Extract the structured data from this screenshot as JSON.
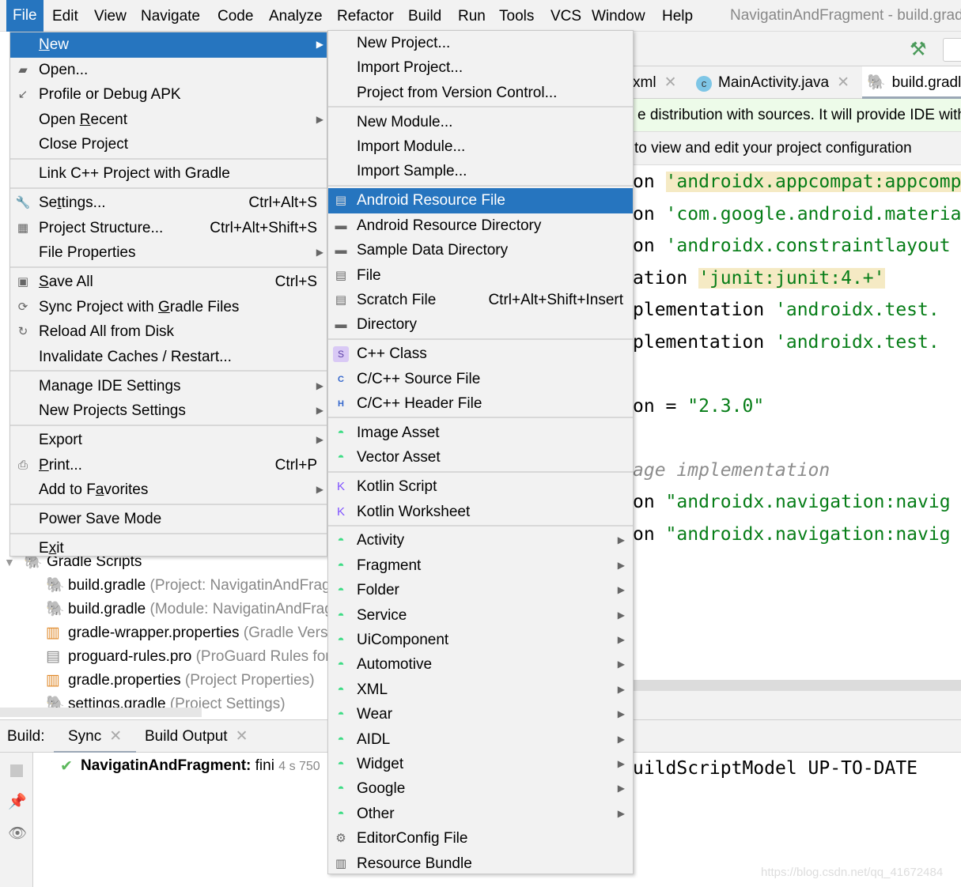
{
  "menubar": {
    "items": [
      "File",
      "Edit",
      "View",
      "Navigate",
      "Code",
      "Analyze",
      "Refactor",
      "Build",
      "Run",
      "Tools",
      "VCS",
      "Window",
      "Help"
    ],
    "active": "File"
  },
  "window_title": "NavigatinAndFragment - build.gradle",
  "editor_tabs": [
    {
      "label": "xml",
      "icon": "xml-icon"
    },
    {
      "label": "MainActivity.java",
      "icon": "class-c-icon"
    },
    {
      "label": "build.gradle",
      "icon": "gradle-elephant-icon",
      "selected": true
    }
  ],
  "notifications": [
    "e distribution with sources. It will provide IDE with",
    "to view and edit your project configuration"
  ],
  "code_lines": [
    [
      {
        "t": "on "
      },
      {
        "t": "'androidx.appcompat:appcompat",
        "c": "str hl"
      }
    ],
    [
      {
        "t": "on "
      },
      {
        "t": "'com.google.android.material",
        "c": "str"
      }
    ],
    [
      {
        "t": "on "
      },
      {
        "t": "'androidx.constraintlayout",
        "c": "str"
      }
    ],
    [
      {
        "t": "ation "
      },
      {
        "t": "'junit:junit:4.+'",
        "c": "str hl"
      }
    ],
    [
      {
        "t": "plementation "
      },
      {
        "t": "'androidx.test.",
        "c": "str"
      }
    ],
    [
      {
        "t": "plementation "
      },
      {
        "t": "'androidx.test.",
        "c": "str"
      }
    ],
    [],
    [
      {
        "t": "on = "
      },
      {
        "t": "\"2.3.0\"",
        "c": "str"
      }
    ],
    [],
    [
      {
        "t": "age implementation",
        "c": "cm"
      }
    ],
    [
      {
        "t": "on "
      },
      {
        "t": "\"androidx.navigation:navig",
        "c": "str"
      }
    ],
    [
      {
        "t": "on "
      },
      {
        "t": "\"androidx.navigation:navig",
        "c": "str"
      }
    ]
  ],
  "project_tree": {
    "root": "Gradle Scripts",
    "items": [
      {
        "name": "build.gradle",
        "hint": "(Project: NavigatinAndFragment)",
        "icon": "gradle-elephant-icon"
      },
      {
        "name": "build.gradle",
        "hint": "(Module: NavigatinAndFragment.app)",
        "icon": "gradle-elephant-icon"
      },
      {
        "name": "gradle-wrapper.properties",
        "hint": "(Gradle Version)",
        "icon": "properties-file-icon"
      },
      {
        "name": "proguard-rules.pro",
        "hint": "(ProGuard Rules for app)",
        "icon": "text-file-icon"
      },
      {
        "name": "gradle.properties",
        "hint": "(Project Properties)",
        "icon": "properties-file-icon"
      },
      {
        "name": "settings.gradle",
        "hint": "(Project Settings)",
        "icon": "gradle-elephant-icon"
      }
    ]
  },
  "build_panel": {
    "label": "Build:",
    "tabs": [
      "Sync",
      "Build Output"
    ],
    "status_title": "NavigatinAndFragment:",
    "status_text": "fini",
    "duration": "4 s 750",
    "output": "uildScriptModel UP-TO-DATE"
  },
  "file_menu": [
    {
      "label": "New",
      "u": 0,
      "arrow": true,
      "selected": true
    },
    {
      "label": "Open...",
      "icon": "folder-open-icon",
      "glyph": "▰"
    },
    {
      "label": "Profile or Debug APK",
      "icon": "profile-apk-icon",
      "glyph": "↙"
    },
    {
      "label": "Open Recent",
      "u": 5,
      "arrow": true
    },
    {
      "label": "Close Project"
    },
    {
      "sep": true
    },
    {
      "label": "Link C++ Project with Gradle"
    },
    {
      "sep": true
    },
    {
      "label": "Settings...",
      "u": 2,
      "shortcut": "Ctrl+Alt+S",
      "icon": "wrench-icon",
      "glyph": "🔧"
    },
    {
      "label": "Project Structure...",
      "shortcut": "Ctrl+Alt+Shift+S",
      "icon": "project-structure-icon",
      "glyph": "▦"
    },
    {
      "label": "File Properties",
      "arrow": true
    },
    {
      "sep": true
    },
    {
      "label": "Save All",
      "u": 0,
      "shortcut": "Ctrl+S",
      "icon": "save-icon",
      "glyph": "▣"
    },
    {
      "label": "Sync Project with Gradle Files",
      "u": 18,
      "icon": "gradle-sync-icon",
      "glyph": "⟳"
    },
    {
      "label": "Reload All from Disk",
      "icon": "reload-icon",
      "glyph": "↻"
    },
    {
      "label": "Invalidate Caches / Restart..."
    },
    {
      "sep": true
    },
    {
      "label": "Manage IDE Settings",
      "arrow": true
    },
    {
      "label": "New Projects Settings",
      "arrow": true
    },
    {
      "sep": true
    },
    {
      "label": "Export",
      "arrow": true
    },
    {
      "label": "Print...",
      "u": 0,
      "shortcut": "Ctrl+P",
      "icon": "printer-icon",
      "glyph": "⎙"
    },
    {
      "label": "Add to Favorites",
      "u": 8,
      "arrow": true
    },
    {
      "sep": true
    },
    {
      "label": "Power Save Mode"
    },
    {
      "sep": true
    },
    {
      "label": "Exit",
      "u": 1
    }
  ],
  "new_menu": [
    {
      "label": "New Project..."
    },
    {
      "label": "Import Project..."
    },
    {
      "label": "Project from Version Control..."
    },
    {
      "sep": true
    },
    {
      "label": "New Module..."
    },
    {
      "label": "Import Module..."
    },
    {
      "label": "Import Sample..."
    },
    {
      "sep": true
    },
    {
      "label": "Android Resource File",
      "selected": true,
      "icon": "android-resource-file-icon",
      "glyph": "▤"
    },
    {
      "label": "Android Resource Directory",
      "icon": "folder-icon",
      "glyph": "▬"
    },
    {
      "label": "Sample Data Directory",
      "icon": "folder-icon",
      "glyph": "▬"
    },
    {
      "label": "File",
      "icon": "file-icon",
      "glyph": "▤"
    },
    {
      "label": "Scratch File",
      "shortcut": "Ctrl+Alt+Shift+Insert",
      "icon": "scratch-file-icon",
      "glyph": "▤"
    },
    {
      "label": "Directory",
      "icon": "folder-icon",
      "glyph": "▬"
    },
    {
      "sep": true
    },
    {
      "label": "C++ Class",
      "icon": "cpp-class-icon",
      "glyph": "S"
    },
    {
      "label": "C/C++ Source File",
      "icon": "cpp-source-icon",
      "glyph": "C"
    },
    {
      "label": "C/C++ Header File",
      "icon": "cpp-header-icon",
      "glyph": "H"
    },
    {
      "sep": true
    },
    {
      "label": "Image Asset",
      "icon": "android-icon",
      "glyph": "◓"
    },
    {
      "label": "Vector Asset",
      "icon": "android-icon",
      "glyph": "◓"
    },
    {
      "sep": true
    },
    {
      "label": "Kotlin Script",
      "icon": "kotlin-icon",
      "glyph": "K"
    },
    {
      "label": "Kotlin Worksheet",
      "icon": "kotlin-icon",
      "glyph": "K"
    },
    {
      "sep": true
    },
    {
      "label": "Activity",
      "arrow": true,
      "icon": "android-icon",
      "glyph": "◓"
    },
    {
      "label": "Fragment",
      "arrow": true,
      "icon": "android-icon",
      "glyph": "◓"
    },
    {
      "label": "Folder",
      "arrow": true,
      "icon": "android-icon",
      "glyph": "◓"
    },
    {
      "label": "Service",
      "arrow": true,
      "icon": "android-icon",
      "glyph": "◓"
    },
    {
      "label": "UiComponent",
      "arrow": true,
      "icon": "android-icon",
      "glyph": "◓"
    },
    {
      "label": "Automotive",
      "arrow": true,
      "icon": "android-icon",
      "glyph": "◓"
    },
    {
      "label": "XML",
      "arrow": true,
      "icon": "android-icon",
      "glyph": "◓"
    },
    {
      "label": "Wear",
      "arrow": true,
      "icon": "android-icon",
      "glyph": "◓"
    },
    {
      "label": "AIDL",
      "arrow": true,
      "icon": "android-icon",
      "glyph": "◓"
    },
    {
      "label": "Widget",
      "arrow": true,
      "icon": "android-icon",
      "glyph": "◓"
    },
    {
      "label": "Google",
      "arrow": true,
      "icon": "android-icon",
      "glyph": "◓"
    },
    {
      "label": "Other",
      "arrow": true,
      "icon": "android-icon",
      "glyph": "◓"
    },
    {
      "label": "EditorConfig File",
      "icon": "gear-icon",
      "glyph": "⚙"
    },
    {
      "label": "Resource Bundle",
      "icon": "properties-file-icon",
      "glyph": "▥"
    }
  ],
  "watermark": "https://blog.csdn.net/qq_41672484",
  "colors": {
    "selection": "#2675bf",
    "string": "#067d17",
    "android": "#3ddc84",
    "menu_bg": "#f2f2f2"
  }
}
